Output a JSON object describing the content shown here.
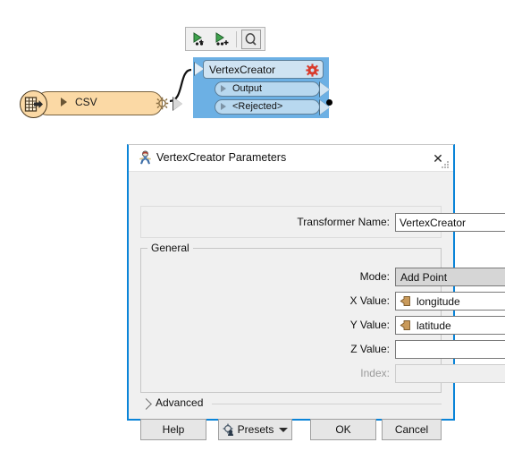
{
  "canvas": {
    "toolbar": {
      "buttons": [
        {
          "name": "run-to-this-icon",
          "label": "Run To This"
        },
        {
          "name": "run-from-this-icon",
          "label": "Run From This"
        },
        {
          "name": "inspect-icon",
          "label": "Inspect"
        }
      ]
    },
    "nodes": [
      {
        "id": "csv-reader",
        "label": "CSV",
        "icon": "csv-reader-icon",
        "gear": "gear-icon",
        "color": "#fbd9a5"
      },
      {
        "id": "vertexcreator",
        "title": "VertexCreator",
        "gear": "gear-icon",
        "gear_color": "#d93a2b",
        "color": "#6cb0e4",
        "ports": [
          "Output",
          "<Rejected>"
        ]
      }
    ]
  },
  "dialog": {
    "title": "VertexCreator Parameters",
    "icon": "fme-transformer-icon",
    "close_label": "✕",
    "transformer_name": {
      "label": "Transformer Name:",
      "value": "VertexCreator"
    },
    "general": {
      "legend": "General",
      "fields": [
        {
          "name": "mode",
          "label": "Mode:",
          "value": "Add Point",
          "control": "combobox",
          "disabled": false,
          "focused": false,
          "has_attr_icon": false
        },
        {
          "name": "x-value",
          "label": "X Value:",
          "value": "longitude",
          "control": "text",
          "disabled": false,
          "focused": false,
          "has_attr_icon": true
        },
        {
          "name": "y-value",
          "label": "Y Value:",
          "value": "latitude",
          "control": "text",
          "disabled": false,
          "focused": true,
          "has_attr_icon": true
        },
        {
          "name": "z-value",
          "label": "Z Value:",
          "value": "",
          "control": "text",
          "disabled": false,
          "focused": false,
          "has_attr_icon": false
        },
        {
          "name": "index",
          "label": "Index:",
          "value": "",
          "control": "text",
          "disabled": true,
          "focused": false,
          "has_attr_icon": false
        }
      ]
    },
    "advanced": {
      "label": "Advanced",
      "expanded": false,
      "chevron": "chevron-right-icon"
    },
    "buttons": [
      {
        "name": "help-button",
        "label": "Help"
      },
      {
        "name": "presets-button",
        "label": "Presets",
        "icon": "presets-icon",
        "has_caret": true
      },
      {
        "name": "ok-button",
        "label": "OK"
      },
      {
        "name": "cancel-button",
        "label": "Cancel"
      }
    ]
  },
  "colors": {
    "accent": "#0a84d8",
    "node_blue": "#6cb0e4",
    "node_tan": "#fbd9a5",
    "gear_red": "#d93a2b",
    "attr_tan": "#c99a5b"
  }
}
